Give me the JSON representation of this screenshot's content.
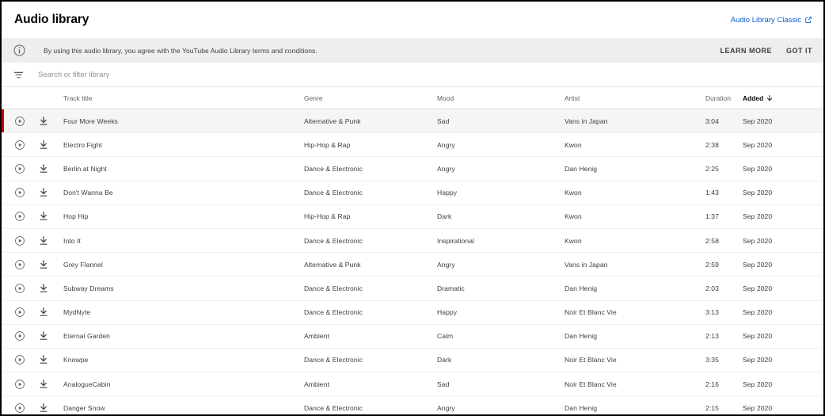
{
  "header": {
    "title": "Audio library",
    "classic_link": {
      "label": "Audio Library Classic",
      "icon": "external-link-icon"
    }
  },
  "notice": {
    "icon": "info-icon",
    "text": "By using this audio library, you agree with the YouTube Audio Library terms and conditions.",
    "learn_more_label": "LEARN MORE",
    "got_it_label": "GOT IT"
  },
  "search": {
    "icon": "filter-list-icon",
    "value": "",
    "placeholder": "Search or filter library"
  },
  "table": {
    "columns": {
      "track_title": "Track title",
      "genre": "Genre",
      "mood": "Mood",
      "artist": "Artist",
      "duration": "Duration",
      "added": "Added"
    },
    "sort": {
      "column": "added",
      "direction": "descending",
      "icon": "arrow-downward-icon"
    },
    "row_icons": {
      "play": "play-circle-icon",
      "download": "download-icon"
    },
    "selected_row_index": 0,
    "accent_color": "#cc0000",
    "rows": [
      {
        "title": "Four More Weeks",
        "genre": "Alternative & Punk",
        "mood": "Sad",
        "artist": "Vans in Japan",
        "duration": "3:04",
        "added": "Sep 2020"
      },
      {
        "title": "Electro Fight",
        "genre": "Hip-Hop & Rap",
        "mood": "Angry",
        "artist": "Kwon",
        "duration": "2:38",
        "added": "Sep 2020"
      },
      {
        "title": "Berlin at Night",
        "genre": "Dance & Electronic",
        "mood": "Angry",
        "artist": "Dan Henig",
        "duration": "2:25",
        "added": "Sep 2020"
      },
      {
        "title": "Don't Wanna Be",
        "genre": "Dance & Electronic",
        "mood": "Happy",
        "artist": "Kwon",
        "duration": "1:43",
        "added": "Sep 2020"
      },
      {
        "title": "Hop Hip",
        "genre": "Hip-Hop & Rap",
        "mood": "Dark",
        "artist": "Kwon",
        "duration": "1:37",
        "added": "Sep 2020"
      },
      {
        "title": "Into It",
        "genre": "Dance & Electronic",
        "mood": "Inspirational",
        "artist": "Kwon",
        "duration": "2:58",
        "added": "Sep 2020"
      },
      {
        "title": "Grey Flannel",
        "genre": "Alternative & Punk",
        "mood": "Angry",
        "artist": "Vans in Japan",
        "duration": "2:59",
        "added": "Sep 2020"
      },
      {
        "title": "Subway Dreams",
        "genre": "Dance & Electronic",
        "mood": "Dramatic",
        "artist": "Dan Henig",
        "duration": "2:03",
        "added": "Sep 2020"
      },
      {
        "title": "MydNyte",
        "genre": "Dance & Electronic",
        "mood": "Happy",
        "artist": "Noir Et Blanc Vie",
        "duration": "3:13",
        "added": "Sep 2020"
      },
      {
        "title": "Eternal Garden",
        "genre": "Ambient",
        "mood": "Calm",
        "artist": "Dan Henig",
        "duration": "2:13",
        "added": "Sep 2020"
      },
      {
        "title": "Knowpe",
        "genre": "Dance & Electronic",
        "mood": "Dark",
        "artist": "Noir Et Blanc Vie",
        "duration": "3:35",
        "added": "Sep 2020"
      },
      {
        "title": "AnalogueCabin",
        "genre": "Ambient",
        "mood": "Sad",
        "artist": "Noir Et Blanc Vie",
        "duration": "2:16",
        "added": "Sep 2020"
      },
      {
        "title": "Danger Snow",
        "genre": "Dance & Electronic",
        "mood": "Angry",
        "artist": "Dan Henig",
        "duration": "2:15",
        "added": "Sep 2020"
      }
    ]
  }
}
